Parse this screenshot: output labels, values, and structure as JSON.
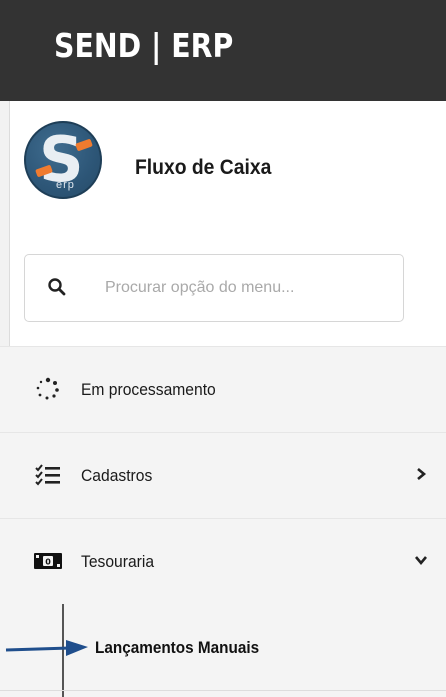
{
  "header": {
    "brand": "SEND | ERP"
  },
  "app": {
    "title": "Fluxo de Caixa",
    "logo_text": "erp"
  },
  "search": {
    "placeholder": "Procurar opção do menu..."
  },
  "menu": {
    "items": [
      {
        "label": "Em processamento",
        "icon": "spinner-icon",
        "chevron": "none"
      },
      {
        "label": "Cadastros",
        "icon": "checklist-icon",
        "chevron": "chevron-right-icon"
      },
      {
        "label": "Tesouraria",
        "icon": "money-icon",
        "chevron": "chevron-down-icon"
      }
    ],
    "submenu": [
      {
        "label": "Lançamentos Manuais"
      }
    ]
  },
  "colors": {
    "topbar": "#333333",
    "accent": "#f07b2f",
    "arrow": "#1f4e8c",
    "logo": "#2d5677"
  }
}
